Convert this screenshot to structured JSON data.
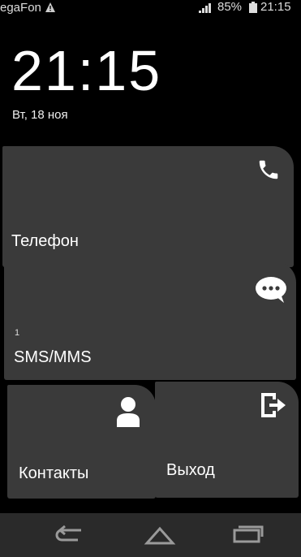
{
  "status_bar": {
    "carrier": "egaFon",
    "battery_percent": "85%",
    "time": "21:15"
  },
  "lockscreen": {
    "clock": "21:15",
    "date": "Вт, 18 ноя"
  },
  "tiles": {
    "phone": {
      "label": "Телефон",
      "icon": "phone-icon"
    },
    "sms": {
      "label": "SMS/MMS",
      "badge": "1",
      "icon": "message-bubble-icon"
    },
    "contacts": {
      "label": "Контакты",
      "icon": "person-icon"
    },
    "exit": {
      "label": "Выход",
      "icon": "exit-icon"
    }
  },
  "nav_bar": {
    "back_icon": "back-icon",
    "home_icon": "home-icon",
    "recent_icon": "recent-apps-icon"
  },
  "colors": {
    "background": "#000000",
    "tile": "#3a3a3a",
    "nav": "#2a2a2a",
    "text": "#ffffff"
  }
}
